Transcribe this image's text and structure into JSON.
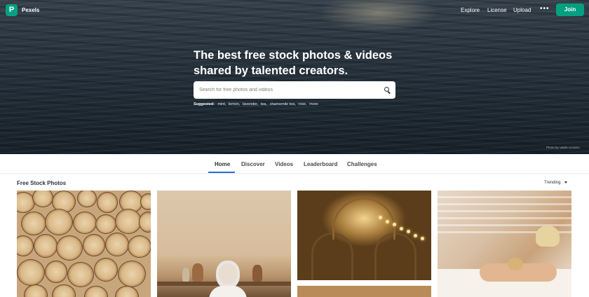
{
  "nav": {
    "brand": "Pexels",
    "logo_glyph": "P",
    "links": [
      {
        "label": "Explore"
      },
      {
        "label": "License"
      },
      {
        "label": "Upload"
      }
    ],
    "more_glyph": "•••",
    "join_label": "Join"
  },
  "hero": {
    "headline_line1": "The best free stock photos & videos",
    "headline_line2": "shared by talented creators.",
    "search_placeholder": "Search for free photos and videos",
    "suggested_label": "Suggested:",
    "suggestions": [
      "mint,",
      "lemon,",
      "lavender,",
      "tea,",
      "chamomile tea,",
      "rose,",
      "more"
    ],
    "photo_credit": "Photo by Vasile Urcianu"
  },
  "tabs": [
    {
      "label": "Home",
      "active": true
    },
    {
      "label": "Discover",
      "active": false
    },
    {
      "label": "Videos",
      "active": false
    },
    {
      "label": "Leaderboard",
      "active": false
    },
    {
      "label": "Challenges",
      "active": false
    }
  ],
  "feed": {
    "title": "Free Stock Photos",
    "sort_label": "Trending"
  },
  "colors": {
    "brand_green": "#05a081",
    "active_tab_underline": "#2c6fd0",
    "text_dark": "#2c343e"
  },
  "icons": {
    "search": "search-icon",
    "more": "more-horizontal-icon",
    "sort_caret": "caret-down-icon"
  }
}
